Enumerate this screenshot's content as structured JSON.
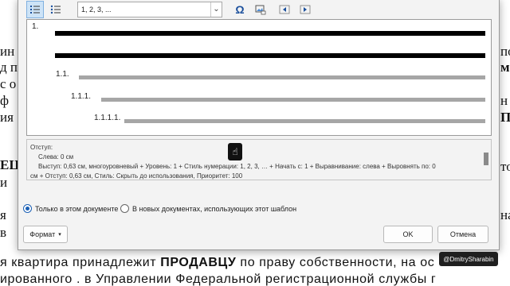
{
  "background": {
    "left_fragments": [
      "ин",
      "д п",
      "с о",
      "ф",
      "ия",
      "ЕЦ",
      "и",
      "я",
      "в"
    ],
    "right_fragments": [
      "пор",
      "мы",
      "н",
      "П",
      "тор",
      "ната"
    ],
    "line1_normal_a": "я квартира принадлежит ",
    "line1_bold": "ПРОДАВЦУ",
    "line1_normal_b": " по праву собственности, на ос",
    "line2": "ированного      . в Управлении Федеральной регистрационной службы г"
  },
  "toolbar": {
    "numbering_format": "1, 2, 3, ...",
    "icons": [
      "numbered-list-icon",
      "bulleted-list-icon",
      "omega-symbol-icon",
      "picture-bullet-icon",
      "decrease-indent-icon",
      "increase-indent-icon"
    ]
  },
  "preview": {
    "labels": [
      "1.",
      "1.1.",
      "1.1.1.",
      "1.1.1.1."
    ],
    "colors": {
      "level1": "#000000",
      "sublevels": "#a6a6a6"
    }
  },
  "description": {
    "heading": "Отступ:",
    "left": "Слева:  0 см",
    "detail1": "Выступ:  0,63 см, многоуровневый + Уровень: 1 + Стиль нумерации: 1, 2, 3, … + Начать с: 1 + Выравнивание: слева + Выровнять по:  0",
    "detail2": "см + Отступ:  0,63 см, Стиль: Скрыть до использования, Приоритет: 100"
  },
  "options": {
    "this_document": "Только в этом документе",
    "new_documents": "В новых документах, использующих этот шаблон"
  },
  "buttons": {
    "format": "Формат",
    "ok": "OK",
    "cancel": "Отмена"
  },
  "watermark": "@DmitrySharabin"
}
